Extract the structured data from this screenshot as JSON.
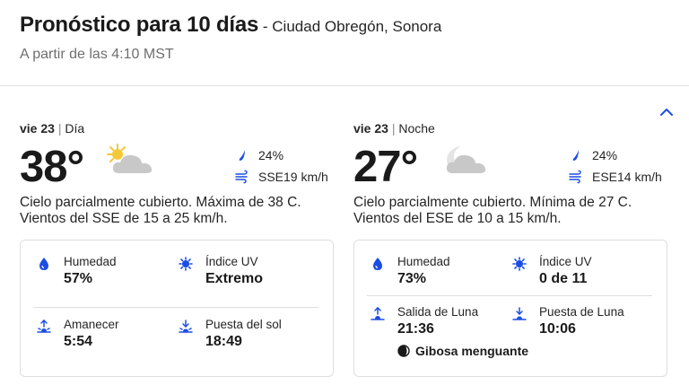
{
  "header": {
    "title": "Pronóstico para 10 días",
    "location": " - Ciudad Obregón, Sonora",
    "subtitle": "A partir de las 4:10 MST"
  },
  "colors": {
    "accent_blue": "#1b4de4",
    "sun_yellow": "#f5c836",
    "cloud_gray": "#c8c8c8",
    "divider": "#dedede"
  },
  "day": {
    "day_label": "vie 23",
    "period_label": "Día",
    "temperature": "38°",
    "condition_icon": "partly-cloudy-day-icon",
    "rain_chance": "24%",
    "wind": "SSE19 km/h",
    "narrative": "Cielo parcialmente cubierto. Máxima de 38 C. Vientos del SSE de 15 a 25 km/h.",
    "details": {
      "humidity_label": "Humedad",
      "humidity_value": "57%",
      "uv_label": "Índice UV",
      "uv_value": "Extremo",
      "sunrise_label": "Amanecer",
      "sunrise_value": "5:54",
      "sunset_label": "Puesta del sol",
      "sunset_value": "18:49"
    }
  },
  "night": {
    "day_label": "vie 23",
    "period_label": "Noche",
    "temperature": "27°",
    "condition_icon": "partly-cloudy-night-icon",
    "rain_chance": "24%",
    "wind": "ESE14 km/h",
    "narrative": "Cielo parcialmente cubierto. Mínima de 27 C. Vientos del ESE de 10 a 15 km/h.",
    "details": {
      "humidity_label": "Humedad",
      "humidity_value": "73%",
      "uv_label": "Índice UV",
      "uv_value": "0 de 11",
      "moonrise_label": "Salida de Luna",
      "moonrise_value": "21:36",
      "moonset_label": "Puesta de Luna",
      "moonset_value": "10:06",
      "moon_phase": "Gibosa menguante"
    }
  }
}
